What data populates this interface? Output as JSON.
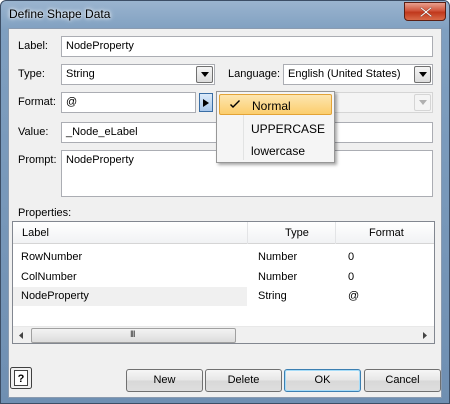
{
  "window": {
    "title": "Define Shape Data"
  },
  "form": {
    "label_caption": "Label:",
    "label_value": "NodeProperty",
    "type_caption": "Type:",
    "type_value": "String",
    "language_caption": "Language:",
    "language_value": "English (United States)",
    "format_caption": "Format:",
    "format_value": "@",
    "value_caption": "Value:",
    "value_value": "_Node_eLabel",
    "prompt_caption": "Prompt:",
    "prompt_value": "NodeProperty"
  },
  "format_menu": {
    "items": [
      {
        "label": "Normal",
        "checked": true
      },
      {
        "label": "UPPERCASE",
        "checked": false
      },
      {
        "label": "lowercase",
        "checked": false
      }
    ]
  },
  "properties": {
    "caption": "Properties:",
    "columns": [
      "Label",
      "Type",
      "Format"
    ],
    "rows": [
      {
        "label": "RowNumber",
        "type": "Number",
        "format": "0"
      },
      {
        "label": "ColNumber",
        "type": "Number",
        "format": "0"
      },
      {
        "label": "NodeProperty",
        "type": "String",
        "format": "@"
      }
    ],
    "scroll_grip": "III"
  },
  "buttons": {
    "new": "New",
    "delete": "Delete",
    "ok": "OK",
    "cancel": "Cancel"
  },
  "icons": {
    "close": "close-icon",
    "help": "help-icon",
    "check": "check-icon",
    "arrow": "chevron-down-icon",
    "format_menu": "chevron-right-icon"
  }
}
